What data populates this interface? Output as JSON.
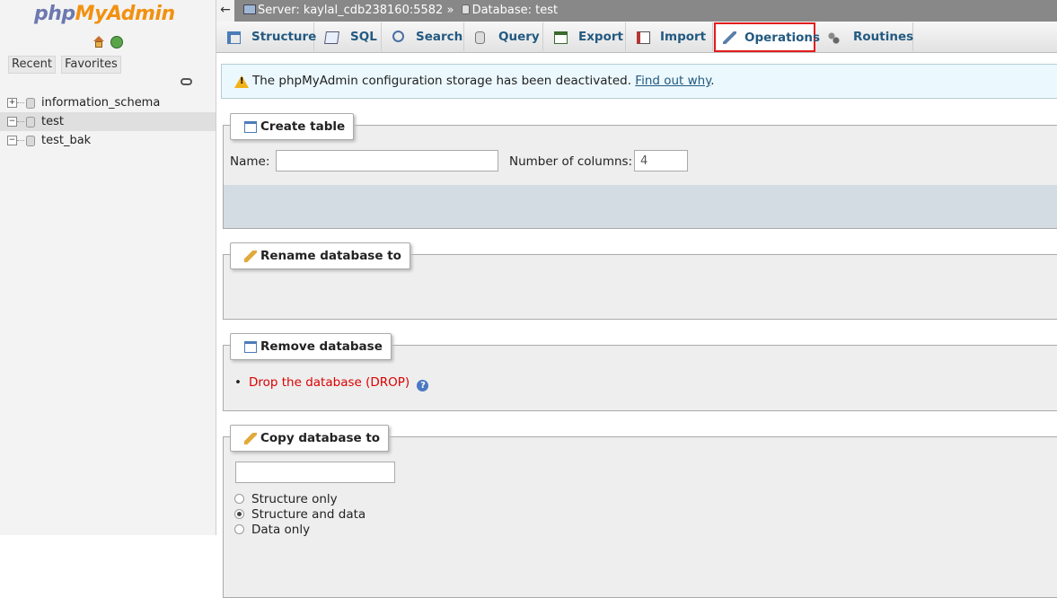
{
  "nav": {
    "logo_php": "php",
    "logo_myadmin": "MyAdmin",
    "tab_recent": "Recent",
    "tab_favorites": "Favorites",
    "databases": [
      {
        "name": "information_schema",
        "expander": "+"
      },
      {
        "name": "test",
        "expander": "−",
        "active": true
      },
      {
        "name": "test_bak",
        "expander": "−"
      }
    ]
  },
  "breadcrumb": {
    "back": "←",
    "server": "Server: kaylal_cdb238160:5582",
    "sep": "»",
    "database": "Database: test"
  },
  "tabs": [
    {
      "label": "Structure",
      "icon": "structure-icon"
    },
    {
      "label": "SQL",
      "icon": "sql-icon"
    },
    {
      "label": "Search",
      "icon": "search-icon"
    },
    {
      "label": "Query",
      "icon": "query-icon"
    },
    {
      "label": "Export",
      "icon": "export-icon"
    },
    {
      "label": "Import",
      "icon": "import-icon"
    },
    {
      "label": "Operations",
      "icon": "wrench-icon",
      "active": true
    },
    {
      "label": "Routines",
      "icon": "routines-icon"
    }
  ],
  "notice": {
    "text": "The phpMyAdmin configuration storage has been deactivated. ",
    "link": "Find out why",
    "end": "."
  },
  "create_table": {
    "legend": "Create table",
    "name_label": "Name:",
    "name_value": "",
    "columns_label": "Number of columns:",
    "columns_value": "4"
  },
  "rename": {
    "legend": "Rename database to"
  },
  "remove": {
    "legend": "Remove database",
    "drop_link": "Drop the database (DROP)",
    "help": "?"
  },
  "copy": {
    "legend": "Copy database to",
    "name_value": "",
    "options": [
      {
        "label": "Structure only",
        "checked": false
      },
      {
        "label": "Structure and data",
        "checked": true
      },
      {
        "label": "Data only",
        "checked": false
      }
    ]
  },
  "colors": {
    "accent": "#235a81",
    "active_tab_border": "#e31c1c",
    "drop_link": "#dd0000",
    "logo_php": "#6c78af",
    "logo_myadmin": "#f29111"
  }
}
